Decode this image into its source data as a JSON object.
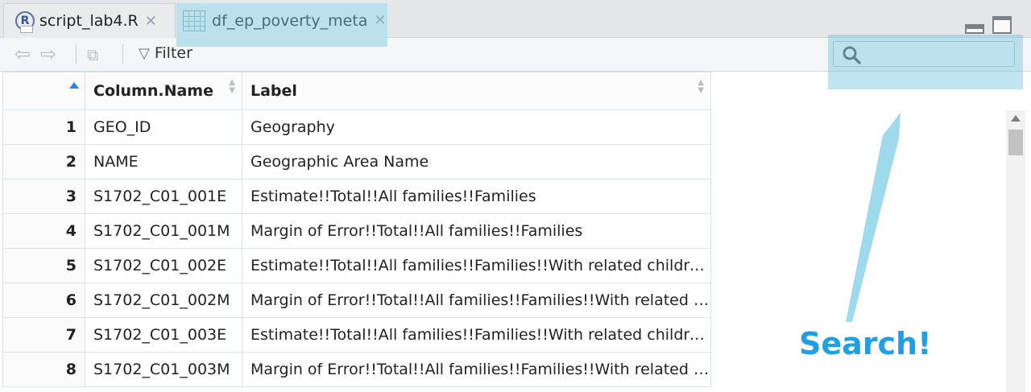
{
  "tabs": [
    {
      "label": "script_lab4.R",
      "icon": "r-script-icon"
    },
    {
      "label": "df_ep_poverty_meta",
      "icon": "data-grid-icon"
    }
  ],
  "toolbar": {
    "filter_label": "Filter",
    "search_placeholder": ""
  },
  "table": {
    "headers": [
      "",
      "Column.Name",
      "Label"
    ],
    "rows": [
      {
        "n": "1",
        "name": "GEO_ID",
        "label": "Geography"
      },
      {
        "n": "2",
        "name": "NAME",
        "label": "Geographic Area Name"
      },
      {
        "n": "3",
        "name": "S1702_C01_001E",
        "label": "Estimate!!Total!!All families!!Families"
      },
      {
        "n": "4",
        "name": "S1702_C01_001M",
        "label": "Margin of Error!!Total!!All families!!Families"
      },
      {
        "n": "5",
        "name": "S1702_C01_002E",
        "label": "Estimate!!Total!!All families!!Families!!With related children o..."
      },
      {
        "n": "6",
        "name": "S1702_C01_002M",
        "label": "Margin of Error!!Total!!All families!!Families!!With related chi..."
      },
      {
        "n": "7",
        "name": "S1702_C01_003E",
        "label": "Estimate!!Total!!All families!!Families!!With related children o..."
      },
      {
        "n": "8",
        "name": "S1702_C01_003M",
        "label": "Margin of Error!!Total!!All families!!Families!!With related chi..."
      }
    ]
  },
  "annotation": {
    "text": "Search!",
    "color": "#1ea0e6"
  },
  "colors": {
    "highlight": "#76c6de",
    "sort_accent": "#1e88e5"
  }
}
